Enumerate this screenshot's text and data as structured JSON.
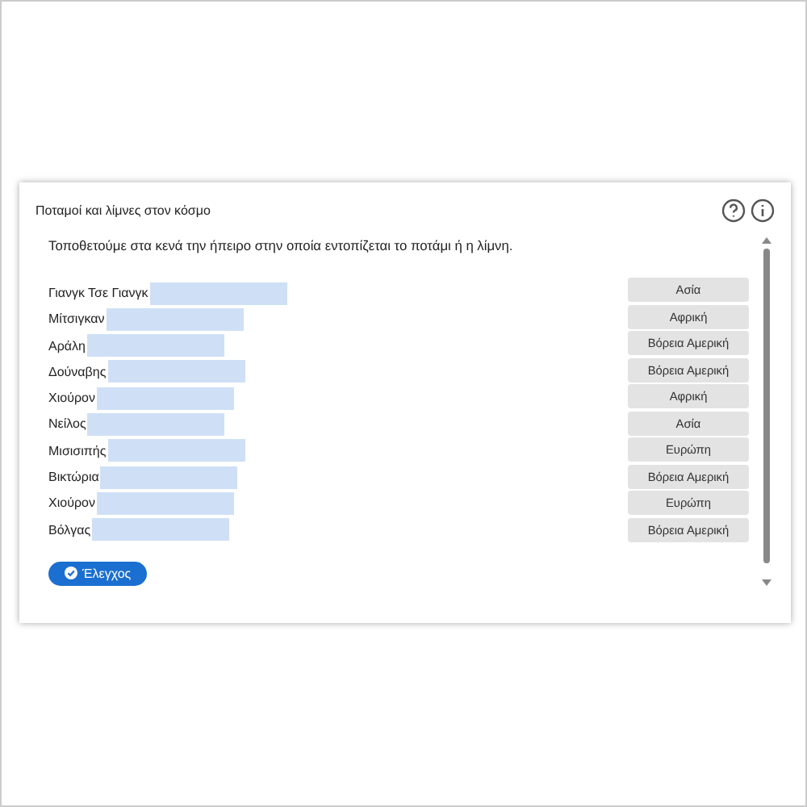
{
  "card": {
    "title": "Ποταμοί και λίμνες στον κόσμο",
    "instruction": "Τοποθετούμε στα κενά την ήπειρο στην οποία εντοπίζεται το ποτάμι ή η λίμνη.",
    "rows": [
      {
        "label": "Γιανγκ Τσε Γιανγκ"
      },
      {
        "label": "Μίτσιγκαν"
      },
      {
        "label": "Αράλη"
      },
      {
        "label": "Δούναβης"
      },
      {
        "label": "Χιούρον"
      },
      {
        "label": "Νείλος"
      },
      {
        "label": "Μισισιπής"
      },
      {
        "label": "Βικτώρια"
      },
      {
        "label": "Χιούρον"
      },
      {
        "label": "Βόλγας"
      }
    ],
    "options": [
      "Ασία",
      "Αφρική",
      "Βόρεια Αμερική",
      "Βόρεια Αμερική",
      "Αφρική",
      "Ασία",
      "Ευρώπη",
      "Βόρεια Αμερική",
      "Ευρώπη",
      "Βόρεια Αμερική"
    ],
    "check_button": "Έλεγχος"
  }
}
